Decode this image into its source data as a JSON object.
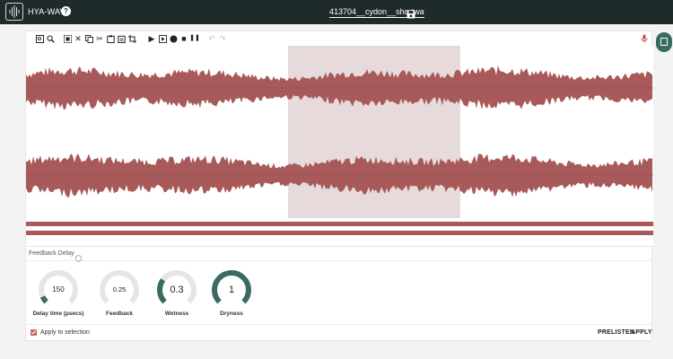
{
  "header": {
    "app_title": "HYA-WAVE",
    "help_icon": "?",
    "file_name": "413704__cydon__shortwa",
    "logo_icon": "waveform-logo-icon",
    "save_icon": "floppy-disk-icon"
  },
  "toolbar": {
    "icons": [
      "zoom-fit-icon",
      "zoom-in-icon",
      "select-all-icon",
      "delete-icon",
      "copy-icon",
      "cut-icon",
      "paste-icon",
      "paste-new-icon",
      "crop-icon",
      "play-icon",
      "play-selection-icon",
      "record-icon",
      "stop-icon",
      "pause-icon",
      "undo-icon",
      "redo-icon",
      "microphone-icon"
    ],
    "glyphs": {
      "delete": "✕",
      "cut": "✂",
      "play": "▶",
      "stop": "■",
      "pause": "❚❚",
      "undo": "↶",
      "redo": "↷"
    }
  },
  "waveform": {
    "color": "#a85a5a",
    "selection_color": "#e6dada"
  },
  "effect": {
    "title": "Feedback Delay",
    "knobs": [
      {
        "label": "Delay time (µsecs)",
        "value": "150",
        "level": 0.08
      },
      {
        "label": "Feedback",
        "value": "0.25",
        "level": 0.0
      },
      {
        "label": "Wetness",
        "value": "0.3",
        "level": 0.3
      },
      {
        "label": "Dryness",
        "value": "1",
        "level": 1.0
      }
    ],
    "accent_color": "#3a6b63",
    "apply_to_selection_label": "Apply to selection",
    "apply_to_selection_checked": true,
    "prelisten_label": "PRELISTEN",
    "apply_label": "APPLY"
  },
  "side_button_icon": "clipboard-icon"
}
